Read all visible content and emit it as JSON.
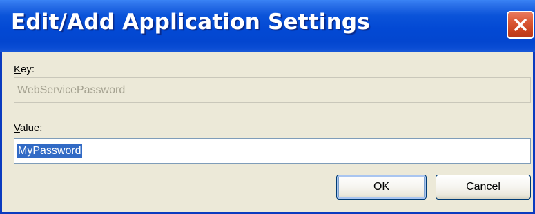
{
  "window": {
    "title": "Edit/Add Application Settings",
    "close_icon": "close-icon"
  },
  "key_field": {
    "label_accel": "K",
    "label_rest": "ey:",
    "value": "WebServicePassword",
    "enabled": false
  },
  "value_field": {
    "label_accel": "V",
    "label_rest": "alue:",
    "value": "MyPassword",
    "selected": true
  },
  "buttons": {
    "ok_label": "OK",
    "cancel_label": "Cancel"
  },
  "colors": {
    "titlebar": "#0349d4",
    "close_button": "#dc5a37",
    "dialog_background": "#ece9d8",
    "selection": "#316ac5"
  }
}
